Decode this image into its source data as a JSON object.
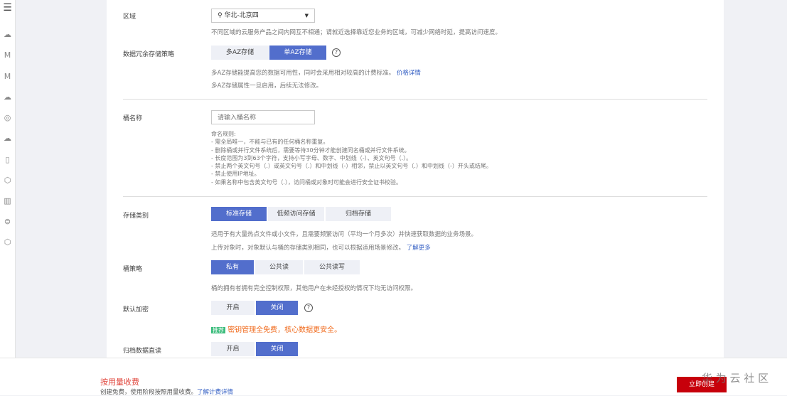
{
  "sidebar": {
    "items": [
      "menu-icon",
      "cloud-icon",
      "model-icon",
      "model-icon",
      "cloud-upload-icon",
      "target-icon",
      "cloud-icon",
      "document-icon",
      "shield-icon",
      "book-icon",
      "storage-icon",
      "hexagon-icon"
    ]
  },
  "region": {
    "label": "区域",
    "value": "华北-北京四",
    "desc": "不同区域的云服务产品之间内网互不相通；请就近选择靠近您业务的区域，可减少网络时延，提高访问速度。"
  },
  "redundancy": {
    "label": "数据冗余存储策略",
    "options": [
      "多AZ存储",
      "单AZ存储"
    ],
    "selected": 1,
    "desc1": "多AZ存储能提高您的数据可用性，同时会采用相对较高的计费标准。",
    "link": "价格详情",
    "desc2": "多AZ存储属性一旦启用，后续无法修改。"
  },
  "bucket": {
    "label": "桶名称",
    "placeholder": "请输入桶名称",
    "rules": [
      "命名规则:",
      "- 需全局唯一，不能与已有的任何桶名称重复。",
      "- 删除桶或并行文件系统后，需要等待30分钟才能创建同名桶或并行文件系统。",
      "- 长度范围为3到63个字符，支持小写字母、数字、中划线（-）、英文句号（.）。",
      "- 禁止两个英文句号（.）或英文句号（.）和中划线（-）相邻，禁止以英文句号（.）和中划线（-）开头或结尾。",
      "- 禁止使用IP地址。",
      "- 如果名称中包含英文句号（.），访问桶或对象时可能会进行安全证书校验。"
    ]
  },
  "storage_class": {
    "label": "存储类别",
    "options": [
      "标准存储",
      "低频访问存储",
      "归档存储"
    ],
    "selected": 0,
    "desc1": "适用于有大量热点文件或小文件，且需要频繁访问（平均一个月多次）并快速获取数据的业务场景。",
    "desc2": "上传对象时，对象默认与桶的存储类别相同，也可以根据适用场景修改。",
    "link": "了解更多"
  },
  "policy": {
    "label": "桶策略",
    "options": [
      "私有",
      "公共读",
      "公共读写"
    ],
    "selected": 0,
    "desc": "桶的拥有者拥有完全控制权限，其他用户在未经授权的情况下均无访问权限。"
  },
  "encryption": {
    "label": "默认加密",
    "options": [
      "开启",
      "关闭"
    ],
    "selected": 1,
    "badge": "推荐",
    "promo": "密钥管理全免费，核心数据更安全。"
  },
  "archive": {
    "label": "归档数据直读",
    "options": [
      "开启",
      "关闭"
    ],
    "selected": 1
  },
  "footer": {
    "title": "按用量收费",
    "desc": "创建免费，使用阶段按照用量收费。",
    "link": "了解计费详情",
    "create": "立即创建",
    "watermark": "华 为 云 社 区"
  },
  "colors": {
    "primary": "#526ecc",
    "danger": "#c7000b",
    "promo": "#f06a1c",
    "badge": "#3dbd7d"
  }
}
